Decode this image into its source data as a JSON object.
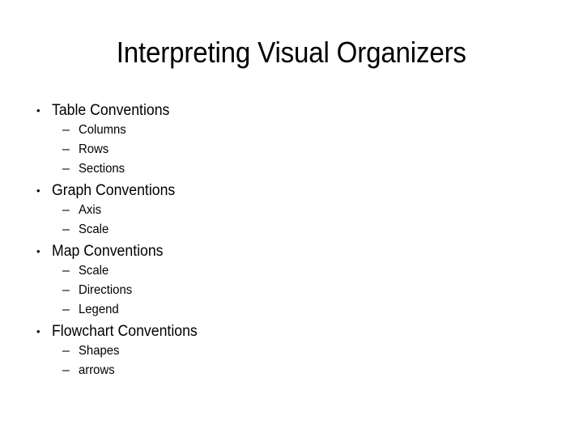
{
  "slide": {
    "title": "Interpreting Visual Organizers",
    "background_color": "#ffffff",
    "text_color": "#000000",
    "level1_bullet_glyph": "•",
    "level2_bullet_glyph": "–",
    "groups": [
      {
        "label": "Table Conventions",
        "items": [
          {
            "label": "Columns"
          },
          {
            "label": "Rows"
          },
          {
            "label": "Sections"
          }
        ]
      },
      {
        "label": "Graph Conventions",
        "items": [
          {
            "label": "Axis"
          },
          {
            "label": "Scale"
          }
        ]
      },
      {
        "label": "Map Conventions",
        "items": [
          {
            "label": "Scale"
          },
          {
            "label": "Directions"
          },
          {
            "label": "Legend"
          }
        ]
      },
      {
        "label": "Flowchart Conventions",
        "items": [
          {
            "label": "Shapes"
          },
          {
            "label": "arrows"
          }
        ]
      }
    ]
  }
}
